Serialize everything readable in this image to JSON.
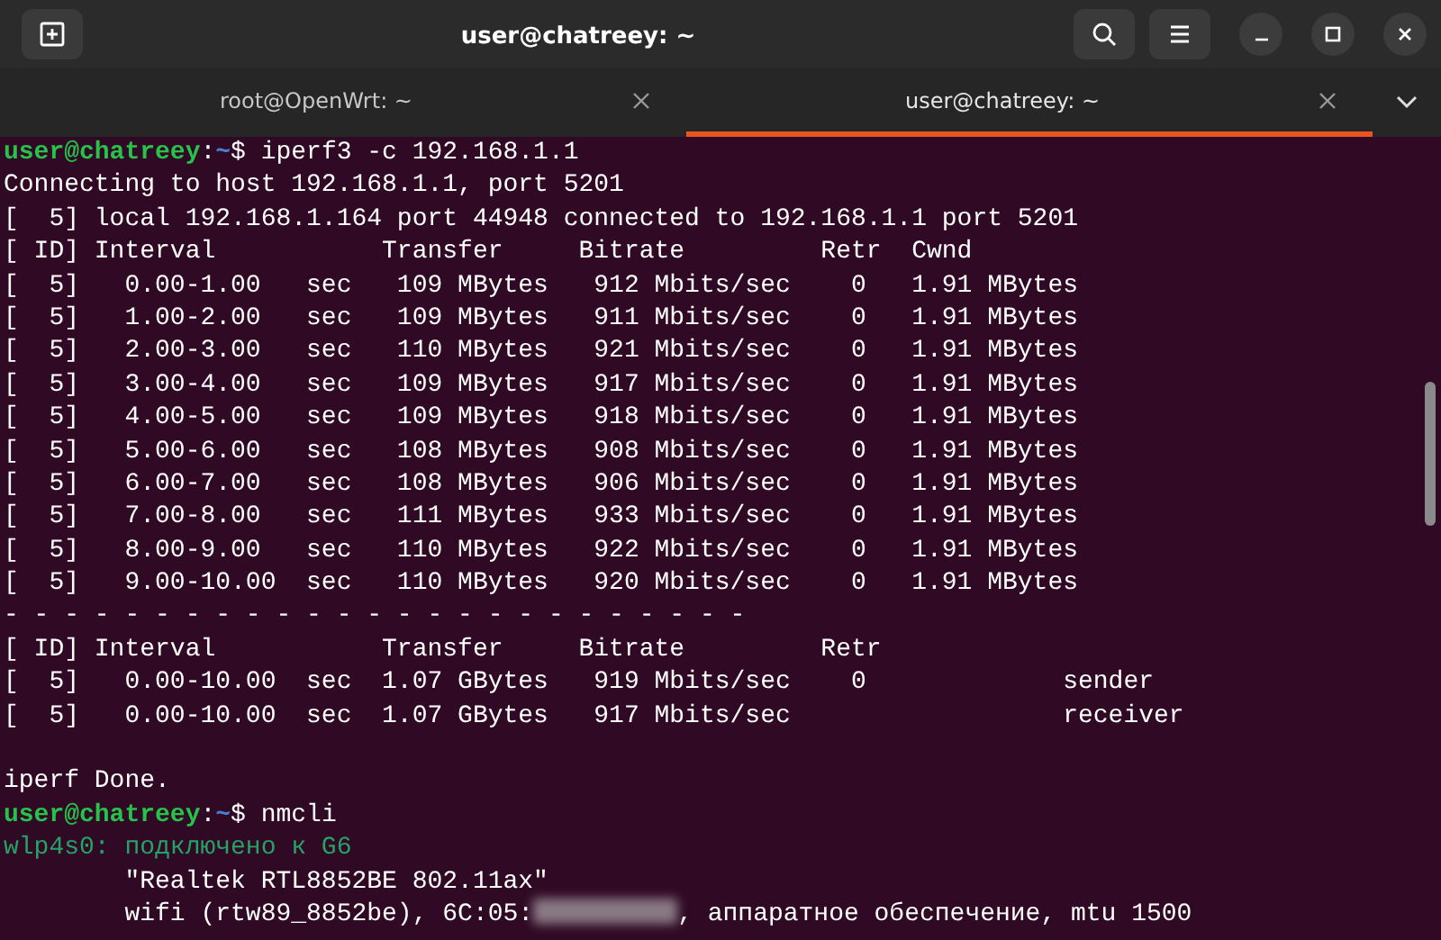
{
  "window": {
    "title": "user@chatreey: ~"
  },
  "tabs": [
    {
      "label": "root@OpenWrt: ~",
      "selected": false
    },
    {
      "label": "user@chatreey: ~",
      "selected": true
    }
  ],
  "terminal": {
    "lines": [
      {
        "kind": "prompt",
        "user_host": "user@chatreey",
        "separator": ":",
        "path": "~",
        "symbol": "$",
        "command": "iperf3 -c 192.168.1.1"
      },
      {
        "kind": "output",
        "text": "Connecting to host 192.168.1.1, port 5201"
      },
      {
        "kind": "output",
        "text": "[  5] local 192.168.1.164 port 44948 connected to 192.168.1.1 port 5201"
      },
      {
        "kind": "output",
        "text": "[ ID] Interval           Transfer     Bitrate         Retr  Cwnd"
      },
      {
        "kind": "output",
        "text": "[  5]   0.00-1.00   sec   109 MBytes   912 Mbits/sec    0   1.91 MBytes"
      },
      {
        "kind": "output",
        "text": "[  5]   1.00-2.00   sec   109 MBytes   911 Mbits/sec    0   1.91 MBytes"
      },
      {
        "kind": "output",
        "text": "[  5]   2.00-3.00   sec   110 MBytes   921 Mbits/sec    0   1.91 MBytes"
      },
      {
        "kind": "output",
        "text": "[  5]   3.00-4.00   sec   109 MBytes   917 Mbits/sec    0   1.91 MBytes"
      },
      {
        "kind": "output",
        "text": "[  5]   4.00-5.00   sec   109 MBytes   918 Mbits/sec    0   1.91 MBytes"
      },
      {
        "kind": "output",
        "text": "[  5]   5.00-6.00   sec   108 MBytes   908 Mbits/sec    0   1.91 MBytes"
      },
      {
        "kind": "output",
        "text": "[  5]   6.00-7.00   sec   108 MBytes   906 Mbits/sec    0   1.91 MBytes"
      },
      {
        "kind": "output",
        "text": "[  5]   7.00-8.00   sec   111 MBytes   933 Mbits/sec    0   1.91 MBytes"
      },
      {
        "kind": "output",
        "text": "[  5]   8.00-9.00   sec   110 MBytes   922 Mbits/sec    0   1.91 MBytes"
      },
      {
        "kind": "output",
        "text": "[  5]   9.00-10.00  sec   110 MBytes   920 Mbits/sec    0   1.91 MBytes"
      },
      {
        "kind": "output",
        "text": "- - - - - - - - - - - - - - - - - - - - - - - - -"
      },
      {
        "kind": "output",
        "text": "[ ID] Interval           Transfer     Bitrate         Retr"
      },
      {
        "kind": "output",
        "text": "[  5]   0.00-10.00  sec  1.07 GBytes   919 Mbits/sec    0             sender"
      },
      {
        "kind": "output",
        "text": "[  5]   0.00-10.00  sec  1.07 GBytes   917 Mbits/sec                  receiver"
      },
      {
        "kind": "blank"
      },
      {
        "kind": "output",
        "text": "iperf Done."
      },
      {
        "kind": "prompt",
        "user_host": "user@chatreey",
        "separator": ":",
        "path": "~",
        "symbol": "$",
        "command": "nmcli"
      },
      {
        "kind": "status",
        "text": "wlp4s0: подключено к G6"
      },
      {
        "kind": "output",
        "text": "        \"Realtek RTL8852BE 802.11ax\""
      },
      {
        "kind": "redacted",
        "before": "        wifi (rtw89_8852be), 6C:05:",
        "after": ", аппаратное обеспечение, mtu 1500"
      }
    ]
  }
}
